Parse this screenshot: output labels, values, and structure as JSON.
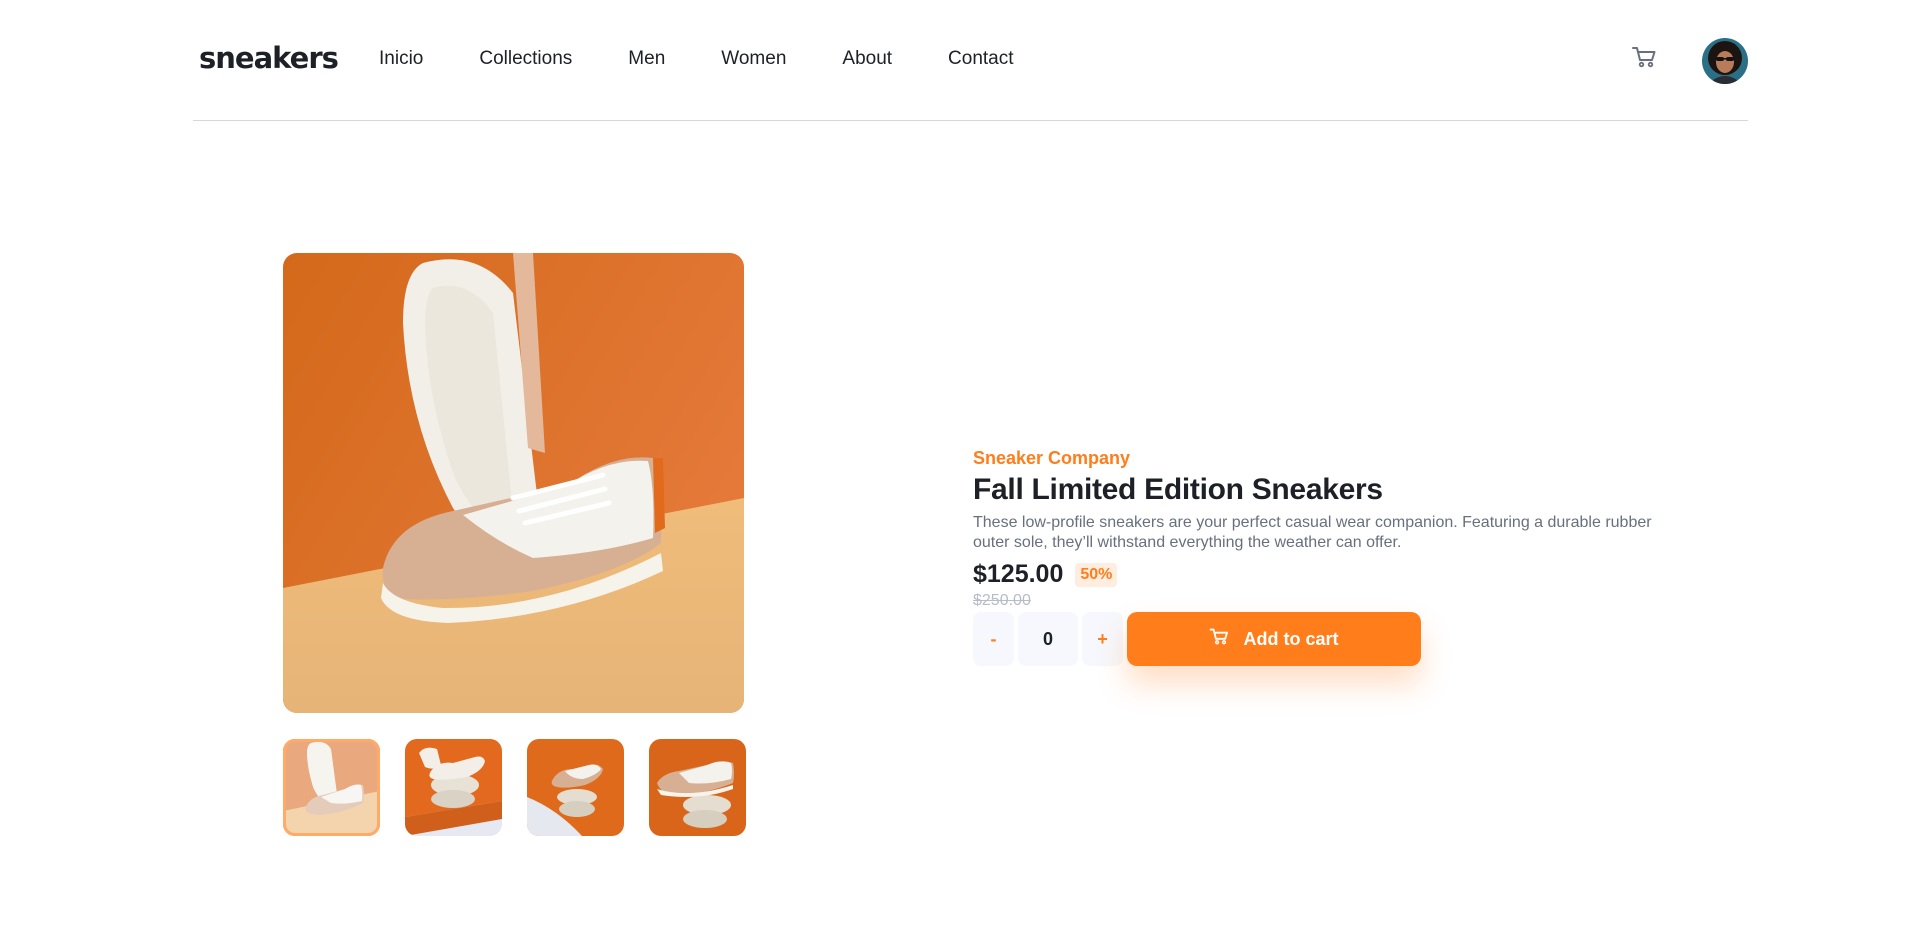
{
  "header": {
    "logo": "sneakers",
    "nav": [
      "Inicio",
      "Collections",
      "Men",
      "Women",
      "About",
      "Contact"
    ],
    "cart_icon": "cart-icon",
    "avatar_icon": "user-avatar"
  },
  "colors": {
    "accent": "#ff7d1a",
    "accent_pale": "#ffede0",
    "text_dark": "#1d2026",
    "text_muted": "#68707d",
    "text_light": "#b6bcc8",
    "input_bg": "#f6f8fd"
  },
  "gallery": {
    "main_image": "sneaker-product-photo",
    "thumbnails": [
      "sneaker-thumb-1",
      "sneaker-thumb-2",
      "sneaker-thumb-3",
      "sneaker-thumb-4"
    ],
    "active_thumbnail": 0
  },
  "product": {
    "company": "Sneaker Company",
    "title": "Fall Limited Edition Sneakers",
    "description": "These low-profile sneakers are your perfect casual wear companion. Featuring a durable rubber outer sole, they’ll withstand everything the weather can offer.",
    "price": "$125.00",
    "discount": "50%",
    "original_price": "$250.00"
  },
  "cart_controls": {
    "minus": "-",
    "quantity": "0",
    "plus": "+",
    "add_label": "Add to cart",
    "add_icon": "cart-icon"
  }
}
